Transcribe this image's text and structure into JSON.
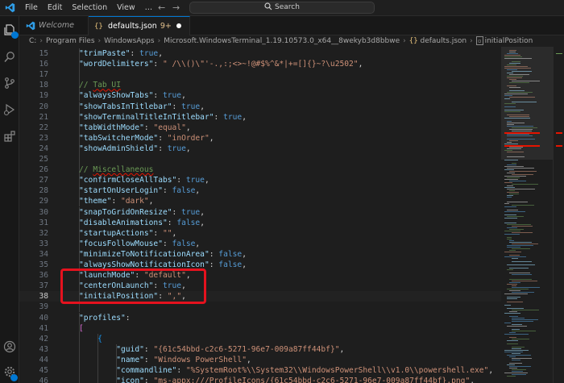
{
  "window": {
    "menu": [
      "File",
      "Edit",
      "Selection",
      "View"
    ],
    "more_menu": "…",
    "search_label": "Search"
  },
  "activity_bar": {
    "icons": [
      "explorer-icon",
      "search-icon",
      "source-control-icon",
      "run-debug-icon",
      "extensions-icon",
      "account-icon",
      "manage-gear-icon"
    ]
  },
  "tabs": [
    {
      "label": "Welcome",
      "active": false,
      "icon": "vscode-logo-icon"
    },
    {
      "label": "defaults.json",
      "active": true,
      "icon": "json-braces-icon",
      "problems": "9+",
      "dirty": true
    }
  ],
  "breadcrumb": {
    "parts": [
      "C:",
      "Program Files",
      "WindowsApps",
      "Microsoft.WindowsTerminal_1.19.10573.0_x64__8wekyb3d8bbwe"
    ],
    "file_icon": "{}",
    "file": "defaults.json",
    "symbol_icon": "property-icon",
    "symbol": "initialPosition"
  },
  "editor": {
    "current_line": 38,
    "lines": [
      {
        "n": "15",
        "indent": 1,
        "tokens": [
          [
            "k",
            "\"trimPaste\""
          ],
          [
            "p",
            ": "
          ],
          [
            "b",
            "true"
          ],
          [
            "p",
            ","
          ]
        ]
      },
      {
        "n": "16",
        "indent": 1,
        "tokens": [
          [
            "k",
            "\"wordDelimiters\""
          ],
          [
            "p",
            ": "
          ],
          [
            "s",
            "\" /\\\\()\\\"'-.,:;<>~!@#$%^&*|+=[]{}~?\\u2502\""
          ],
          [
            "p",
            ","
          ]
        ]
      },
      {
        "n": "17",
        "indent": 1,
        "tokens": []
      },
      {
        "n": "18",
        "indent": 1,
        "tokens": [
          [
            "c",
            "// Tab UI"
          ]
        ]
      },
      {
        "n": "19",
        "indent": 1,
        "tokens": [
          [
            "k",
            "\"alwaysShowTabs\""
          ],
          [
            "p",
            ": "
          ],
          [
            "b",
            "true"
          ],
          [
            "p",
            ","
          ]
        ]
      },
      {
        "n": "20",
        "indent": 1,
        "tokens": [
          [
            "k",
            "\"showTabsInTitlebar\""
          ],
          [
            "p",
            ": "
          ],
          [
            "b",
            "true"
          ],
          [
            "p",
            ","
          ]
        ]
      },
      {
        "n": "21",
        "indent": 1,
        "tokens": [
          [
            "k",
            "\"showTerminalTitleInTitlebar\""
          ],
          [
            "p",
            ": "
          ],
          [
            "b",
            "true"
          ],
          [
            "p",
            ","
          ]
        ]
      },
      {
        "n": "22",
        "indent": 1,
        "tokens": [
          [
            "k",
            "\"tabWidthMode\""
          ],
          [
            "p",
            ": "
          ],
          [
            "s",
            "\"equal\""
          ],
          [
            "p",
            ","
          ]
        ]
      },
      {
        "n": "23",
        "indent": 1,
        "tokens": [
          [
            "k",
            "\"tabSwitcherMode\""
          ],
          [
            "p",
            ": "
          ],
          [
            "s",
            "\"inOrder\""
          ],
          [
            "p",
            ","
          ]
        ]
      },
      {
        "n": "24",
        "indent": 1,
        "tokens": [
          [
            "k",
            "\"showAdminShield\""
          ],
          [
            "p",
            ": "
          ],
          [
            "b",
            "true"
          ],
          [
            "p",
            ","
          ]
        ]
      },
      {
        "n": "25",
        "indent": 1,
        "tokens": []
      },
      {
        "n": "26",
        "indent": 1,
        "tokens": [
          [
            "c",
            "// Miscellaneous"
          ]
        ]
      },
      {
        "n": "27",
        "indent": 1,
        "tokens": [
          [
            "k",
            "\"confirmCloseAllTabs\""
          ],
          [
            "p",
            ": "
          ],
          [
            "b",
            "true"
          ],
          [
            "p",
            ","
          ]
        ]
      },
      {
        "n": "28",
        "indent": 1,
        "tokens": [
          [
            "k",
            "\"startOnUserLogin\""
          ],
          [
            "p",
            ": "
          ],
          [
            "b",
            "false"
          ],
          [
            "p",
            ","
          ]
        ]
      },
      {
        "n": "29",
        "indent": 1,
        "tokens": [
          [
            "k",
            "\"theme\""
          ],
          [
            "p",
            ": "
          ],
          [
            "s",
            "\"dark\""
          ],
          [
            "p",
            ","
          ]
        ]
      },
      {
        "n": "30",
        "indent": 1,
        "tokens": [
          [
            "k",
            "\"snapToGridOnResize\""
          ],
          [
            "p",
            ": "
          ],
          [
            "b",
            "true"
          ],
          [
            "p",
            ","
          ]
        ]
      },
      {
        "n": "31",
        "indent": 1,
        "tokens": [
          [
            "k",
            "\"disableAnimations\""
          ],
          [
            "p",
            ": "
          ],
          [
            "b",
            "false"
          ],
          [
            "p",
            ","
          ]
        ]
      },
      {
        "n": "32",
        "indent": 1,
        "tokens": [
          [
            "k",
            "\"startupActions\""
          ],
          [
            "p",
            ": "
          ],
          [
            "s",
            "\"\""
          ],
          [
            "p",
            ","
          ]
        ]
      },
      {
        "n": "33",
        "indent": 1,
        "tokens": [
          [
            "k",
            "\"focusFollowMouse\""
          ],
          [
            "p",
            ": "
          ],
          [
            "b",
            "false"
          ],
          [
            "p",
            ","
          ]
        ]
      },
      {
        "n": "34",
        "indent": 1,
        "tokens": [
          [
            "k",
            "\"minimizeToNotificationArea\""
          ],
          [
            "p",
            ": "
          ],
          [
            "b",
            "false"
          ],
          [
            "p",
            ","
          ]
        ]
      },
      {
        "n": "35",
        "indent": 1,
        "tokens": [
          [
            "k",
            "\"alwaysShowNotificationIcon\""
          ],
          [
            "p",
            ": "
          ],
          [
            "b",
            "false"
          ],
          [
            "p",
            ","
          ]
        ]
      },
      {
        "n": "36",
        "indent": 1,
        "tokens": [
          [
            "k",
            "\"launchMode\""
          ],
          [
            "p",
            ": "
          ],
          [
            "s",
            "\"default\""
          ],
          [
            "p",
            ","
          ]
        ]
      },
      {
        "n": "37",
        "indent": 1,
        "tokens": [
          [
            "k",
            "\"centerOnLaunch\""
          ],
          [
            "p",
            ": "
          ],
          [
            "b",
            "true"
          ],
          [
            "p",
            ","
          ]
        ]
      },
      {
        "n": "38",
        "indent": 1,
        "tokens": [
          [
            "k",
            "\"initialPosition\""
          ],
          [
            "p",
            ": "
          ],
          [
            "s",
            "\",\""
          ],
          [
            "p",
            ","
          ]
        ]
      },
      {
        "n": "39",
        "indent": 1,
        "tokens": []
      },
      {
        "n": "40",
        "indent": 1,
        "tokens": [
          [
            "k",
            "\"profiles\""
          ],
          [
            "p",
            ":"
          ]
        ]
      },
      {
        "n": "41",
        "indent": 1,
        "tokens": [
          [
            "br2",
            "["
          ]
        ]
      },
      {
        "n": "42",
        "indent": 2,
        "tokens": [
          [
            "br3",
            "{"
          ]
        ]
      },
      {
        "n": "43",
        "indent": 3,
        "tokens": [
          [
            "k",
            "\"guid\""
          ],
          [
            "p",
            ": "
          ],
          [
            "s",
            "\"{61c54bbd-c2c6-5271-96e7-009a87ff44bf}\""
          ],
          [
            "p",
            ","
          ]
        ]
      },
      {
        "n": "44",
        "indent": 3,
        "tokens": [
          [
            "k",
            "\"name\""
          ],
          [
            "p",
            ": "
          ],
          [
            "s",
            "\"Windows PowerShell\""
          ],
          [
            "p",
            ","
          ]
        ]
      },
      {
        "n": "45",
        "indent": 3,
        "tokens": [
          [
            "k",
            "\"commandline\""
          ],
          [
            "p",
            ": "
          ],
          [
            "s",
            "\"%SystemRoot%\\\\System32\\\\WindowsPowerShell\\\\v1.0\\\\powershell.exe\""
          ],
          [
            "p",
            ","
          ]
        ]
      },
      {
        "n": "46",
        "indent": 3,
        "tokens": [
          [
            "k",
            "\"icon\""
          ],
          [
            "p",
            ": "
          ],
          [
            "s",
            "\"ms-appx:///ProfileIcons/{61c54bbd-c2c6-5271-96e7-009a87ff44bf}.png\""
          ],
          [
            "p",
            ","
          ]
        ]
      }
    ]
  }
}
